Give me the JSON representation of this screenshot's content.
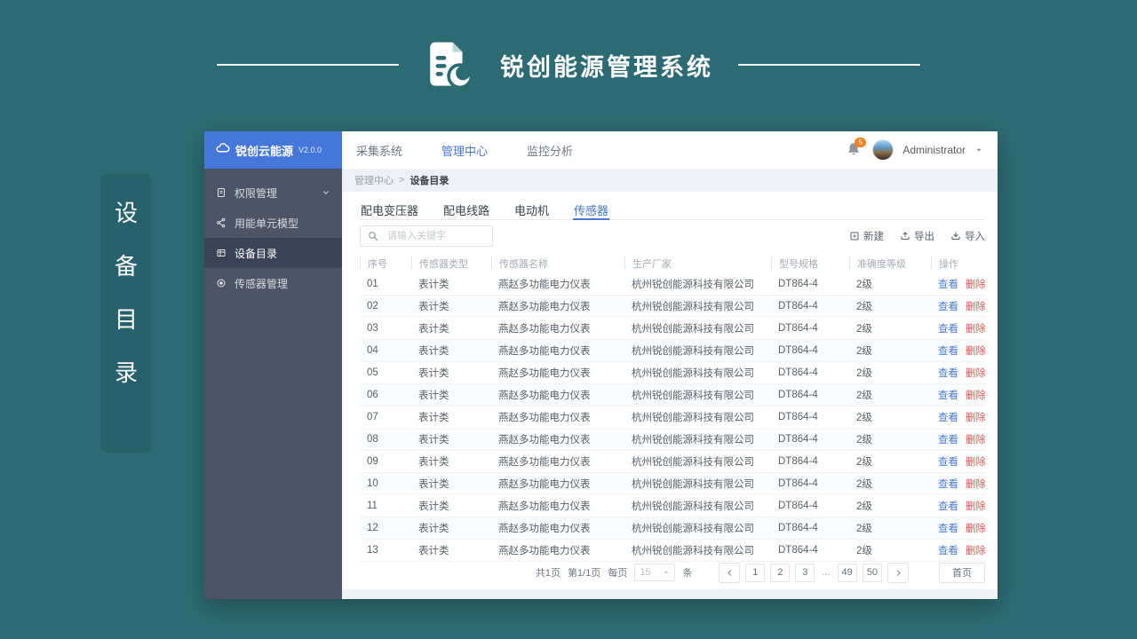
{
  "page": {
    "title": "锐创能源管理系统"
  },
  "side_tag": {
    "chars": [
      "设",
      "备",
      "目",
      "录"
    ]
  },
  "colors": {
    "background_teal": "#2d6b74",
    "accent_blue": "#4577da",
    "view_link_blue": "#4a7bdd",
    "delete_link_red": "#e25757",
    "badge_orange": "#f5821f",
    "sidebar_grey": "#4d5468"
  },
  "window": {
    "sidebar": {
      "logo": {
        "name": "锐创云能源",
        "version": "V2.0.0"
      },
      "items": [
        {
          "label": "权限管理",
          "active": false,
          "expandable": true
        },
        {
          "label": "用能单元模型",
          "active": false
        },
        {
          "label": "设备目录",
          "active": true
        },
        {
          "label": "传感器管理",
          "active": false
        }
      ]
    },
    "topnav": {
      "items": [
        {
          "label": "采集系统",
          "active": false
        },
        {
          "label": "管理中心",
          "active": true
        },
        {
          "label": "监控分析",
          "active": false
        }
      ],
      "notifications_badge": "5",
      "user": "Administrator"
    },
    "breadcrumb": {
      "parent": "管理中心",
      "separator": ">",
      "current": "设备目录"
    },
    "tabs": [
      {
        "label": "配电变压器",
        "active": false
      },
      {
        "label": "配电线路",
        "active": false
      },
      {
        "label": "电动机",
        "active": false
      },
      {
        "label": "传感器",
        "active": true
      }
    ],
    "search_placeholder": "请输入关键字",
    "toolbar": [
      {
        "label": "新建"
      },
      {
        "label": "导出"
      },
      {
        "label": "导入"
      }
    ],
    "table": {
      "columns": [
        "序号",
        "传感器类型",
        "传感器名称",
        "生产厂家",
        "型号规格",
        "准确度等级",
        "操作"
      ],
      "actions": {
        "view": "查看",
        "delete": "删除"
      },
      "rows": [
        {
          "no": "01",
          "type": "表计类",
          "name": "燕赵多功能电力仪表",
          "manufacturer": "杭州锐创能源科技有限公司",
          "model": "DT864-4",
          "accuracy": "2级"
        },
        {
          "no": "02",
          "type": "表计类",
          "name": "燕赵多功能电力仪表",
          "manufacturer": "杭州锐创能源科技有限公司",
          "model": "DT864-4",
          "accuracy": "2级"
        },
        {
          "no": "03",
          "type": "表计类",
          "name": "燕赵多功能电力仪表",
          "manufacturer": "杭州锐创能源科技有限公司",
          "model": "DT864-4",
          "accuracy": "2级"
        },
        {
          "no": "04",
          "type": "表计类",
          "name": "燕赵多功能电力仪表",
          "manufacturer": "杭州锐创能源科技有限公司",
          "model": "DT864-4",
          "accuracy": "2级"
        },
        {
          "no": "05",
          "type": "表计类",
          "name": "燕赵多功能电力仪表",
          "manufacturer": "杭州锐创能源科技有限公司",
          "model": "DT864-4",
          "accuracy": "2级"
        },
        {
          "no": "06",
          "type": "表计类",
          "name": "燕赵多功能电力仪表",
          "manufacturer": "杭州锐创能源科技有限公司",
          "model": "DT864-4",
          "accuracy": "2级"
        },
        {
          "no": "07",
          "type": "表计类",
          "name": "燕赵多功能电力仪表",
          "manufacturer": "杭州锐创能源科技有限公司",
          "model": "DT864-4",
          "accuracy": "2级"
        },
        {
          "no": "08",
          "type": "表计类",
          "name": "燕赵多功能电力仪表",
          "manufacturer": "杭州锐创能源科技有限公司",
          "model": "DT864-4",
          "accuracy": "2级"
        },
        {
          "no": "09",
          "type": "表计类",
          "name": "燕赵多功能电力仪表",
          "manufacturer": "杭州锐创能源科技有限公司",
          "model": "DT864-4",
          "accuracy": "2级"
        },
        {
          "no": "10",
          "type": "表计类",
          "name": "燕赵多功能电力仪表",
          "manufacturer": "杭州锐创能源科技有限公司",
          "model": "DT864-4",
          "accuracy": "2级"
        },
        {
          "no": "11",
          "type": "表计类",
          "name": "燕赵多功能电力仪表",
          "manufacturer": "杭州锐创能源科技有限公司",
          "model": "DT864-4",
          "accuracy": "2级"
        },
        {
          "no": "12",
          "type": "表计类",
          "name": "燕赵多功能电力仪表",
          "manufacturer": "杭州锐创能源科技有限公司",
          "model": "DT864-4",
          "accuracy": "2级"
        },
        {
          "no": "13",
          "type": "表计类",
          "name": "燕赵多功能电力仪表",
          "manufacturer": "杭州锐创能源科技有限公司",
          "model": "DT864-4",
          "accuracy": "2级"
        }
      ]
    },
    "pagination": {
      "total_pages_text": "共1页",
      "current_page_text": "第1/1页",
      "per_page_prefix": "每页",
      "per_page_value": "15",
      "per_page_suffix": "条",
      "pages": [
        "1",
        "2",
        "3",
        "...",
        "49",
        "50"
      ],
      "first_page_label": "首页"
    }
  }
}
